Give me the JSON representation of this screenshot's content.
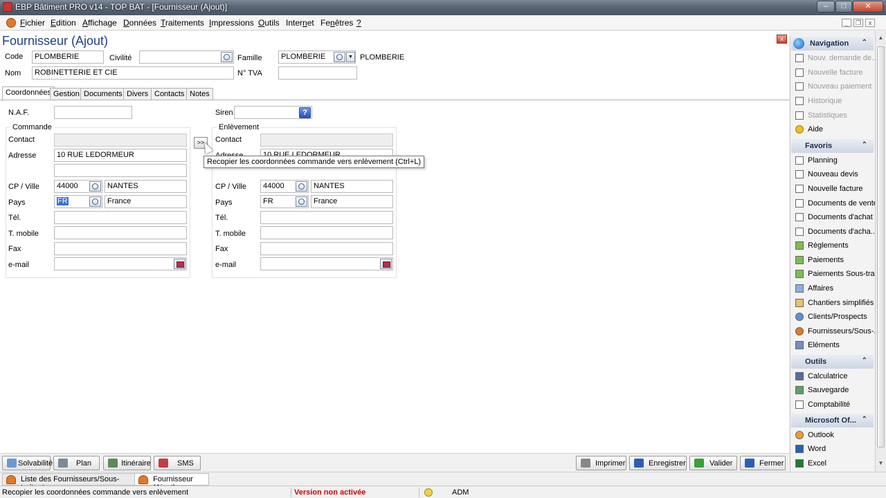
{
  "window": {
    "title": "EBP Bâtiment PRO v14 - TOP BAT - [Fournisseur (Ajout)]",
    "minimize_glyph": "–",
    "maximize_glyph": "□",
    "close_glyph": "✕"
  },
  "menu": {
    "items": [
      {
        "pre": "",
        "key": "F",
        "post": "ichier"
      },
      {
        "pre": "",
        "key": "E",
        "post": "dition"
      },
      {
        "pre": "",
        "key": "A",
        "post": "ffichage"
      },
      {
        "pre": "",
        "key": "D",
        "post": "onnées"
      },
      {
        "pre": "",
        "key": "T",
        "post": "raitements"
      },
      {
        "pre": "",
        "key": "I",
        "post": "mpressions"
      },
      {
        "pre": "",
        "key": "O",
        "post": "utils"
      },
      {
        "pre": "Inter",
        "key": "n",
        "post": "et"
      },
      {
        "pre": "Fe",
        "key": "n",
        "post": "êtres"
      },
      {
        "pre": "",
        "key": "?",
        "post": ""
      }
    ],
    "mdi_min": "_",
    "mdi_restore": "❐",
    "mdi_close": "x"
  },
  "form": {
    "title": "Fournisseur (Ajout)",
    "close_glyph": "x",
    "code_label": "Code",
    "code_value": "PLOMBERIE",
    "civilite_label": "Civilité",
    "civilite_value": "",
    "famille_label": "Famille",
    "famille_value": "PLOMBERIE",
    "famille_text": "PLOMBERIE",
    "nom_label": "Nom",
    "nom_value": "ROBINETTERIE ET CIE",
    "tva_label": "N° TVA",
    "tva_value": ""
  },
  "tabs": [
    "Coordonnées",
    "Gestion",
    "Documents",
    "Divers",
    "Contacts",
    "Notes"
  ],
  "coordonnees": {
    "naf_label": "N.A.F.",
    "naf_value": "",
    "siren_label": "Siren",
    "siren_value": "",
    "siren_help": "?",
    "commande": {
      "title": "Commande",
      "contact_label": "Contact",
      "contact_value": "",
      "adresse_label": "Adresse",
      "adresse_1": "10 RUE LEDORMEUR",
      "adresse_2": "",
      "cpville_label": "CP / Ville",
      "cp": "44000",
      "ville": "NANTES",
      "pays_label": "Pays",
      "pays_code": "FR",
      "pays_name": "France",
      "tel_label": "Tél.",
      "tel_value": "",
      "mobile_label": "T. mobile",
      "mobile_value": "",
      "fax_label": "Fax",
      "fax_value": "",
      "email_label": "e-mail",
      "email_value": ""
    },
    "copy_button": ">>",
    "enlevement": {
      "title": "Enlèvement",
      "contact_label": "Contact",
      "contact_value": "",
      "adresse_label": "Adresse",
      "adresse_1": "10 RUE LEDORMEUR",
      "cpville_label": "CP / Ville",
      "cp": "44000",
      "ville": "NANTES",
      "pays_label": "Pays",
      "pays_code": "FR",
      "pays_name": "France",
      "tel_label": "Tél.",
      "tel_value": "",
      "mobile_label": "T. mobile",
      "mobile_value": "",
      "fax_label": "Fax",
      "fax_value": "",
      "email_label": "e-mail",
      "email_value": ""
    },
    "tooltip": "Recopier les coordonnées commande vers enlèvement (Ctrl+L)"
  },
  "sidepanel": {
    "navigation": {
      "title": "Navigation",
      "items": [
        {
          "label": "Nouv. demande de...",
          "dim": true
        },
        {
          "label": "Nouvelle facture",
          "dim": true
        },
        {
          "label": "Nouveau paiement",
          "dim": true
        },
        {
          "label": "Historique",
          "dim": true
        },
        {
          "label": "Statistiques",
          "dim": true
        },
        {
          "label": "Aide",
          "dim": false
        }
      ]
    },
    "favoris": {
      "title": "Favoris",
      "items": [
        "Planning",
        "Nouveau devis",
        "Nouvelle facture",
        "Documents de vente",
        "Documents d'achat",
        "Documents d'acha...",
        "Règlements",
        "Paiements",
        "Paiements Sous-tra...",
        "Affaires",
        "Chantiers simplifiés",
        "Clients/Prospects",
        "Fournisseurs/Sous-...",
        "Eléments"
      ]
    },
    "outils": {
      "title": "Outils",
      "items": [
        "Calculatrice",
        "Sauvegarde",
        "Comptabilité"
      ]
    },
    "microsoft": {
      "title": "Microsoft Of...",
      "items": [
        "Outlook",
        "Word",
        "Excel"
      ]
    },
    "collapse_glyph": "⌃"
  },
  "bottom_buttons": {
    "left": [
      "Solvabilité",
      "Plan",
      "Itinéraire",
      "SMS"
    ],
    "right": [
      "Imprimer",
      "Enregistrer",
      "Valider",
      "Fermer"
    ]
  },
  "doc_tabs": [
    "Liste des Fournisseurs/Sous-traitants",
    "Fournisseur (Ajout)"
  ],
  "status": {
    "message": "Recopier les coordonnées commande vers enlèvement",
    "version": "Version non activée",
    "user": "ADM"
  },
  "colors": {
    "title_blue": "#1f3f8c",
    "version_red": "#cc0000"
  }
}
